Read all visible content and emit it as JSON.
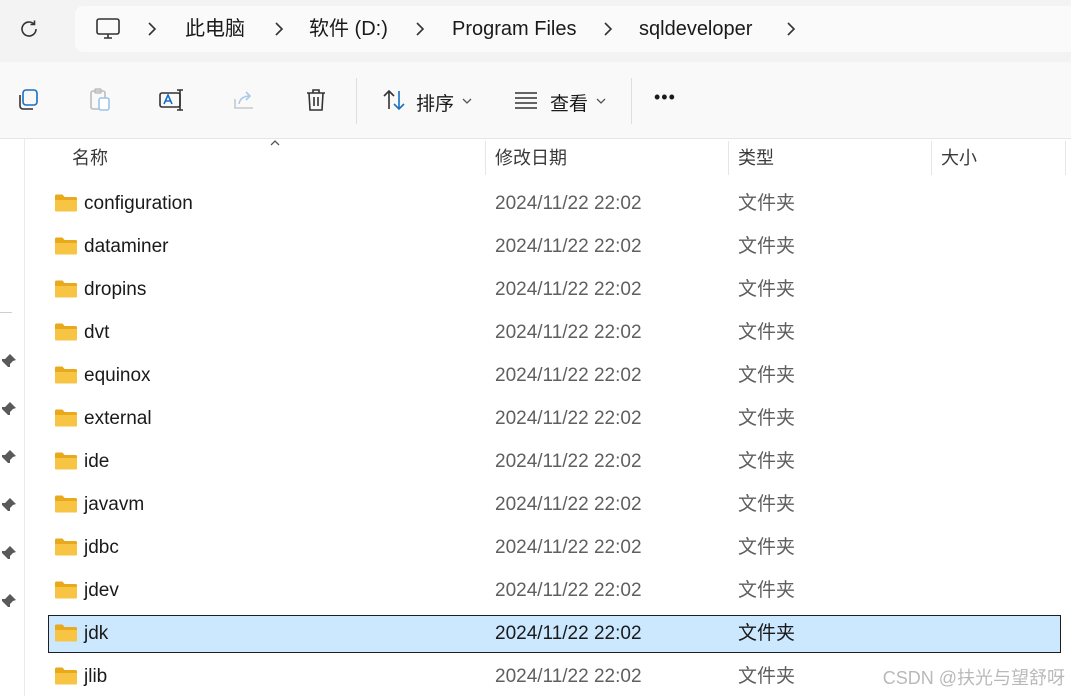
{
  "address_bar": {
    "breadcrumbs": [
      "此电脑",
      "软件 (D:)",
      "Program Files",
      "sqldeveloper"
    ]
  },
  "toolbar": {
    "sort_label": "排序",
    "view_label": "查看",
    "more_label": "•••"
  },
  "columns": {
    "name": "名称",
    "date_modified": "修改日期",
    "type": "类型",
    "size": "大小"
  },
  "files": [
    {
      "name": "configuration",
      "date": "2024/11/22 22:02",
      "type": "文件夹"
    },
    {
      "name": "dataminer",
      "date": "2024/11/22 22:02",
      "type": "文件夹"
    },
    {
      "name": "dropins",
      "date": "2024/11/22 22:02",
      "type": "文件夹"
    },
    {
      "name": "dvt",
      "date": "2024/11/22 22:02",
      "type": "文件夹"
    },
    {
      "name": "equinox",
      "date": "2024/11/22 22:02",
      "type": "文件夹"
    },
    {
      "name": "external",
      "date": "2024/11/22 22:02",
      "type": "文件夹"
    },
    {
      "name": "ide",
      "date": "2024/11/22 22:02",
      "type": "文件夹"
    },
    {
      "name": "javavm",
      "date": "2024/11/22 22:02",
      "type": "文件夹"
    },
    {
      "name": "jdbc",
      "date": "2024/11/22 22:02",
      "type": "文件夹"
    },
    {
      "name": "jdev",
      "date": "2024/11/22 22:02",
      "type": "文件夹"
    },
    {
      "name": "jdk",
      "date": "2024/11/22 22:02",
      "type": "文件夹",
      "selected": true
    },
    {
      "name": "jlib",
      "date": "2024/11/22 22:02",
      "type": "文件夹"
    }
  ],
  "watermark": "CSDN @扶光与望舒呀",
  "colors": {
    "selection": "#cce8ff",
    "folder": "#f8c444"
  }
}
